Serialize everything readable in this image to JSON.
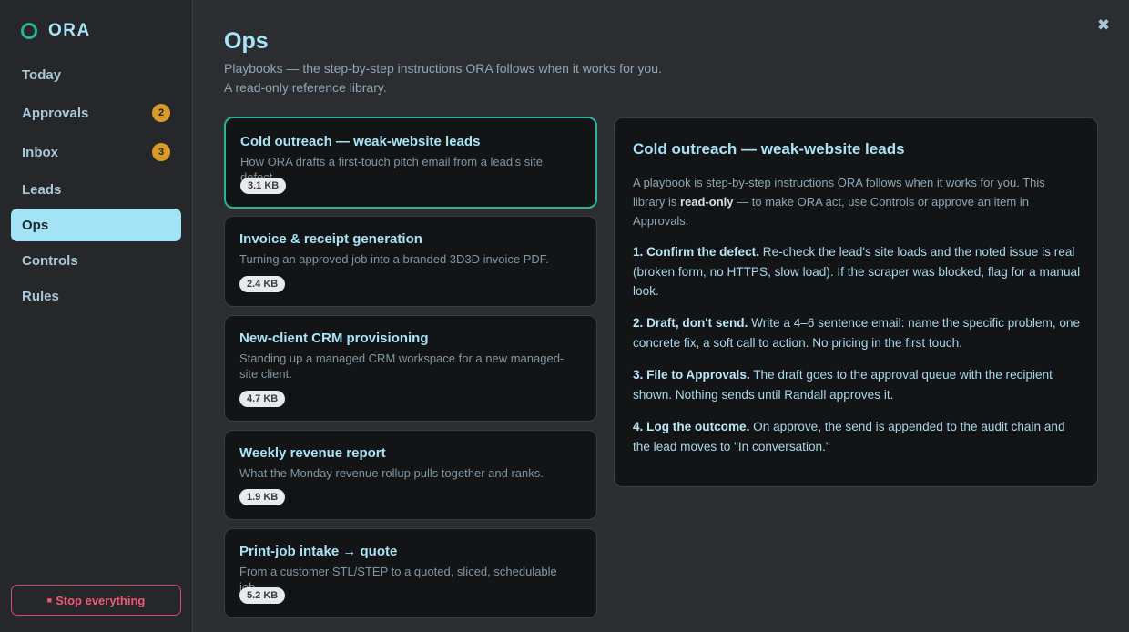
{
  "brand": {
    "name": "ORA",
    "mark_color": "#2bb39a"
  },
  "sidebar": {
    "items": [
      {
        "label": "Today",
        "badge": null,
        "active": false
      },
      {
        "label": "Approvals",
        "badge": "2",
        "active": false
      },
      {
        "label": "Inbox",
        "badge": "3",
        "active": false
      },
      {
        "label": "Leads",
        "badge": null,
        "active": false
      },
      {
        "label": "Ops",
        "badge": null,
        "active": true
      },
      {
        "label": "Controls",
        "badge": null,
        "active": false
      },
      {
        "label": "Rules",
        "badge": null,
        "active": false
      }
    ],
    "stop_button": {
      "glyph": "■",
      "label": "Stop everything"
    }
  },
  "header": {
    "close_glyph": "✖",
    "title": "Ops",
    "subtitle_line1": "Playbooks — the step-by-step instructions ORA follows when it works for you.",
    "subtitle_line2": "A read-only reference library."
  },
  "playbooks": [
    {
      "title": "Cold outreach — weak-website leads",
      "description": "How ORA drafts a first-touch pitch email from a lead's site defect.",
      "size": "3.1 KB",
      "selected": true
    },
    {
      "title": "Invoice & receipt generation",
      "description": "Turning an approved job into a branded 3D3D invoice PDF.",
      "size": "2.4 KB",
      "selected": false
    },
    {
      "title": "New-client CRM provisioning",
      "description": "Standing up a managed CRM workspace for a new managed-site client.",
      "size": "4.7 KB",
      "selected": false
    },
    {
      "title": "Weekly revenue report",
      "description": "What the Monday revenue rollup pulls together and ranks.",
      "size": "1.9 KB",
      "selected": false
    },
    {
      "title": "Print-job intake → quote",
      "description": "From a customer STL/STEP to a quoted, sliced, schedulable job.",
      "size": "5.2 KB",
      "selected": false
    }
  ],
  "detail": {
    "title": "Cold outreach — weak-website leads",
    "intro_before": "A playbook is step-by-step instructions ORA follows when it works for you. This library is ",
    "intro_bold": "read-only",
    "intro_after": " — to make ORA act, use Controls or approve an item in Approvals.",
    "steps": [
      {
        "head": "1. Confirm the defect.",
        "body": " Re-check the lead's site loads and the noted issue is real (broken form, no HTTPS, slow load). If the scraper was blocked, flag for a manual look."
      },
      {
        "head": "2. Draft, don't send.",
        "body": " Write a 4–6 sentence email: name the specific problem, one concrete fix, a soft call to action. No pricing in the first touch."
      },
      {
        "head": "3. File to Approvals.",
        "body": " The draft goes to the approval queue with the recipient shown. Nothing sends until Randall approves it."
      },
      {
        "head": "4. Log the outcome.",
        "body": " On approve, the send is appended to the audit chain and the lead moves to \"In conversation.\""
      }
    ]
  }
}
